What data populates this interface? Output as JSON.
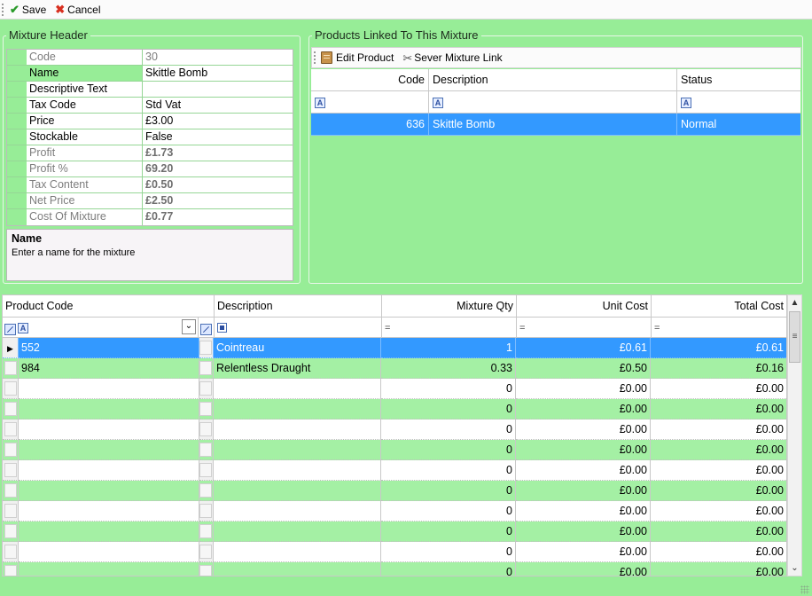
{
  "toolbar": {
    "save_label": "Save",
    "cancel_label": "Cancel",
    "save_icon": "checkmark-icon",
    "cancel_icon": "red-x-icon"
  },
  "mixture_header": {
    "title": "Mixture Header",
    "rows": [
      {
        "name": "Code",
        "value": "30",
        "readonly": true,
        "bold": false
      },
      {
        "name": "Name",
        "value": "Skittle Bomb",
        "readonly": false,
        "bold": false,
        "selected": true
      },
      {
        "name": "Descriptive Text",
        "value": "",
        "readonly": false,
        "bold": false
      },
      {
        "name": "Tax Code",
        "value": "Std Vat",
        "readonly": false,
        "bold": false
      },
      {
        "name": "Price",
        "value": "£3.00",
        "readonly": false,
        "bold": false
      },
      {
        "name": "Stockable",
        "value": "False",
        "readonly": false,
        "bold": false
      },
      {
        "name": "Profit",
        "value": "£1.73",
        "readonly": true,
        "bold": true
      },
      {
        "name": "Profit %",
        "value": "69.20",
        "readonly": true,
        "bold": true
      },
      {
        "name": "Tax Content",
        "value": "£0.50",
        "readonly": true,
        "bold": true
      },
      {
        "name": "Net Price",
        "value": "£2.50",
        "readonly": true,
        "bold": true
      },
      {
        "name": "Cost Of Mixture",
        "value": "£0.77",
        "readonly": true,
        "bold": true
      }
    ],
    "help": {
      "title": "Name",
      "description": "Enter a name for the mixture"
    }
  },
  "linked_products": {
    "title": "Products Linked To This Mixture",
    "edit_label": "Edit Product",
    "sever_label": "Sever Mixture Link",
    "columns": [
      "Code",
      "Description",
      "Status"
    ],
    "rows": [
      {
        "code": "636",
        "description": "Skittle Bomb",
        "status": "Normal"
      }
    ]
  },
  "mixture_lines": {
    "columns": [
      "Product Code",
      "Description",
      "Mixture Qty",
      "Unit Cost",
      "Total Cost"
    ],
    "filter_eq": "=",
    "rows": [
      {
        "code": "552",
        "description": "Cointreau",
        "qty": "1",
        "unit": "£0.61",
        "total": "£0.61"
      },
      {
        "code": "984",
        "description": "Relentless Draught",
        "qty": "0.33",
        "unit": "£0.50",
        "total": "£0.16"
      },
      {
        "code": "",
        "description": "",
        "qty": "0",
        "unit": "£0.00",
        "total": "£0.00"
      },
      {
        "code": "",
        "description": "",
        "qty": "0",
        "unit": "£0.00",
        "total": "£0.00"
      },
      {
        "code": "",
        "description": "",
        "qty": "0",
        "unit": "£0.00",
        "total": "£0.00"
      },
      {
        "code": "",
        "description": "",
        "qty": "0",
        "unit": "£0.00",
        "total": "£0.00"
      },
      {
        "code": "",
        "description": "",
        "qty": "0",
        "unit": "£0.00",
        "total": "£0.00"
      },
      {
        "code": "",
        "description": "",
        "qty": "0",
        "unit": "£0.00",
        "total": "£0.00"
      },
      {
        "code": "",
        "description": "",
        "qty": "0",
        "unit": "£0.00",
        "total": "£0.00"
      },
      {
        "code": "",
        "description": "",
        "qty": "0",
        "unit": "£0.00",
        "total": "£0.00"
      },
      {
        "code": "",
        "description": "",
        "qty": "0",
        "unit": "£0.00",
        "total": "£0.00"
      },
      {
        "code": "",
        "description": "",
        "qty": "0",
        "unit": "£0.00",
        "total": "£0.00"
      }
    ]
  },
  "colors": {
    "panel_green": "#97ed97",
    "row_alt_green": "#a4f0a4",
    "selection_blue": "#3399ff",
    "save_green": "#2a9a2a",
    "cancel_red": "#d83020"
  }
}
